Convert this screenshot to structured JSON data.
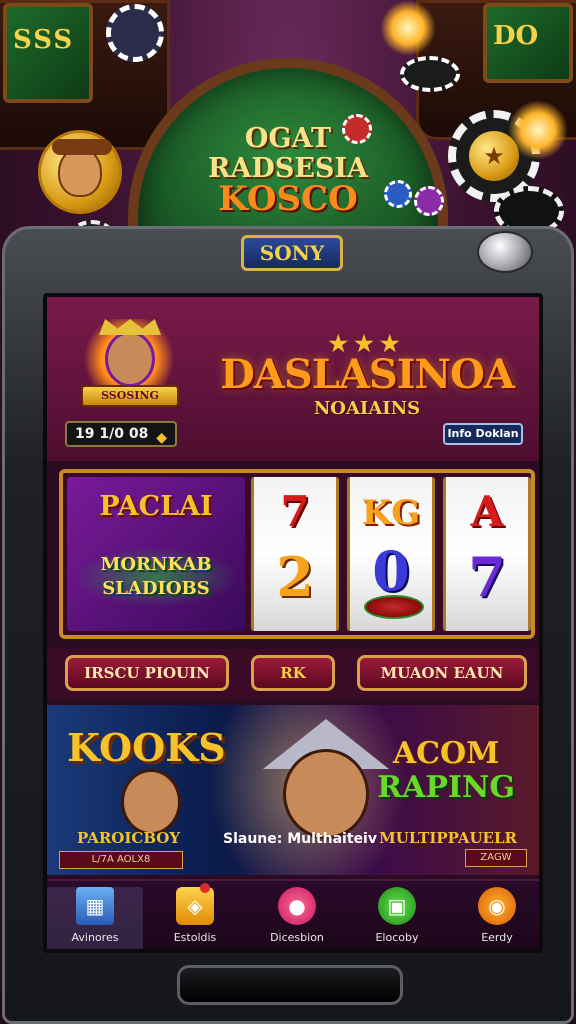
{
  "scene": {
    "left_cabinet_text": "SSS",
    "right_cabinet_text": "DO",
    "table_title": [
      "OGAT",
      "RADSESIA",
      "KOSCO"
    ]
  },
  "machine": {
    "badge": "SONY"
  },
  "header": {
    "brand_logo": "DASLASINOA",
    "brand_sub": "NOAIAINS",
    "stars": "★★★",
    "avatar_name": "SSOSING",
    "credits": "19 1/0 08",
    "info_button": "Info Doklan"
  },
  "reels": {
    "promo_title": "PACLAI",
    "promo_sub": [
      "MORNKAB",
      "SLADIOBS"
    ],
    "reel1": [
      "7",
      "2"
    ],
    "reel2": [
      "KG",
      "0"
    ],
    "reel3": [
      "A",
      "7"
    ]
  },
  "controls": {
    "left": "IRSCU PIOUIN",
    "center": "RK",
    "right": "MUAON EAUN"
  },
  "promo": {
    "left_title": "KOOKS",
    "right_title_top": "ACOM",
    "right_title_bottom": "RAPING",
    "left_label": "PAROICBOY",
    "left_sublabel": "L/7A AOLX8",
    "center_label": "Slaune: Multhaiteiv",
    "right_label": "MULTIPPAUELR",
    "right_sublabel": "ZAGW"
  },
  "nav": [
    {
      "label": "Avinores",
      "icon": "grid-icon"
    },
    {
      "label": "Estoldis",
      "icon": "shield-icon"
    },
    {
      "label": "Dicesbion",
      "icon": "chip-icon"
    },
    {
      "label": "Elocoby",
      "icon": "screen-icon"
    },
    {
      "label": "Eerdy",
      "icon": "coin-icon"
    }
  ],
  "colors": {
    "accent_gold": "#f6c22a",
    "header_bg": "#7a1a4a",
    "reel_border": "#c98a2a"
  }
}
